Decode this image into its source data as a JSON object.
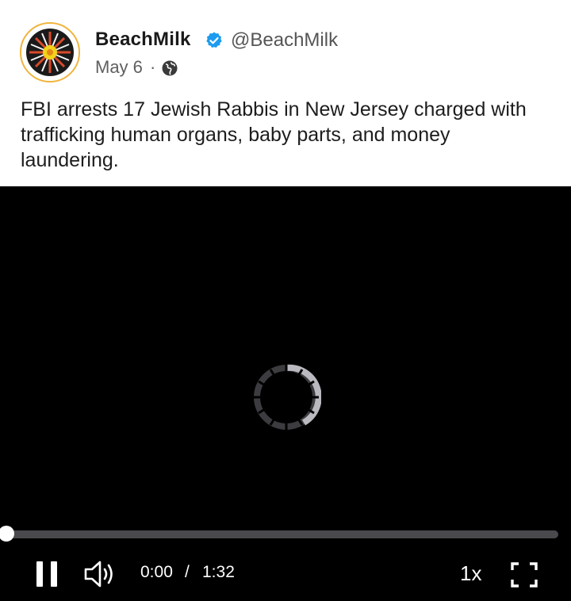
{
  "post": {
    "author_name": "BeachMilk",
    "handle": "@BeachMilk",
    "date": "May 6",
    "separator": "·",
    "visibility_icon": "globe-icon",
    "verified_icon": "verified-badge-icon",
    "text": "FBI arrests 17 Jewish Rabbis in New Jersey charged with trafficking human organs, baby parts, and money laundering."
  },
  "video": {
    "state": "loading",
    "current_time": "0:00",
    "time_separator": "/",
    "duration": "1:32",
    "progress_fraction": 0,
    "speed_label": "1x",
    "play_icon": "pause-icon",
    "volume_icon": "speaker-icon",
    "fullscreen_icon": "fullscreen-icon"
  },
  "colors": {
    "verified_blue": "#1d9bf0",
    "video_background": "#000000",
    "progress_track": "#4a4a4e",
    "avatar_ring": "#f0b43c"
  }
}
